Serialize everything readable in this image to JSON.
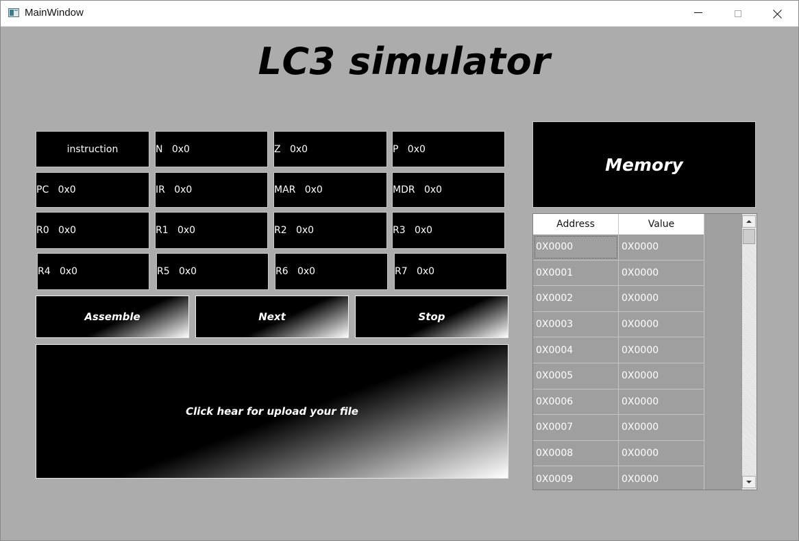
{
  "window": {
    "title": "MainWindow",
    "icon": "app-window-icon",
    "controls": [
      "minimize-icon",
      "maximize-icon",
      "close-icon"
    ]
  },
  "app_title": "LC3 simulator",
  "registers": {
    "instruction": "instruction",
    "N": "N   0x0",
    "Z": "Z   0x0",
    "P": "P   0x0",
    "PC": "PC   0x0",
    "IR": "IR   0x0",
    "MAR": "MAR   0x0",
    "MDR": "MDR   0x0",
    "R0": "R0   0x0",
    "R1": "R1   0x0",
    "R2": "R2   0x0",
    "R3": "R3   0x0",
    "R4": "R4   0x0",
    "R5": "R5   0x0",
    "R6": "R6   0x0",
    "R7": "R7   0x0"
  },
  "buttons": {
    "assemble": "Assemble",
    "next": "Next",
    "stop": "Stop",
    "upload": "Click hear for upload your file"
  },
  "memory": {
    "title": "Memory",
    "columns": {
      "address": "Address",
      "value": "Value"
    },
    "rows": [
      {
        "address": "0X0000",
        "value": "0X0000"
      },
      {
        "address": "0X0001",
        "value": "0X0000"
      },
      {
        "address": "0X0002",
        "value": "0X0000"
      },
      {
        "address": "0X0003",
        "value": "0X0000"
      },
      {
        "address": "0X0004",
        "value": "0X0000"
      },
      {
        "address": "0X0005",
        "value": "0X0000"
      },
      {
        "address": "0X0006",
        "value": "0X0000"
      },
      {
        "address": "0X0007",
        "value": "0X0000"
      },
      {
        "address": "0X0008",
        "value": "0X0000"
      },
      {
        "address": "0X0009",
        "value": "0X0000"
      }
    ]
  },
  "colors": {
    "background": "#acacac",
    "panel": "#000000",
    "text_on_panel": "#ffffff",
    "table_cell": "#9f9f9f"
  }
}
